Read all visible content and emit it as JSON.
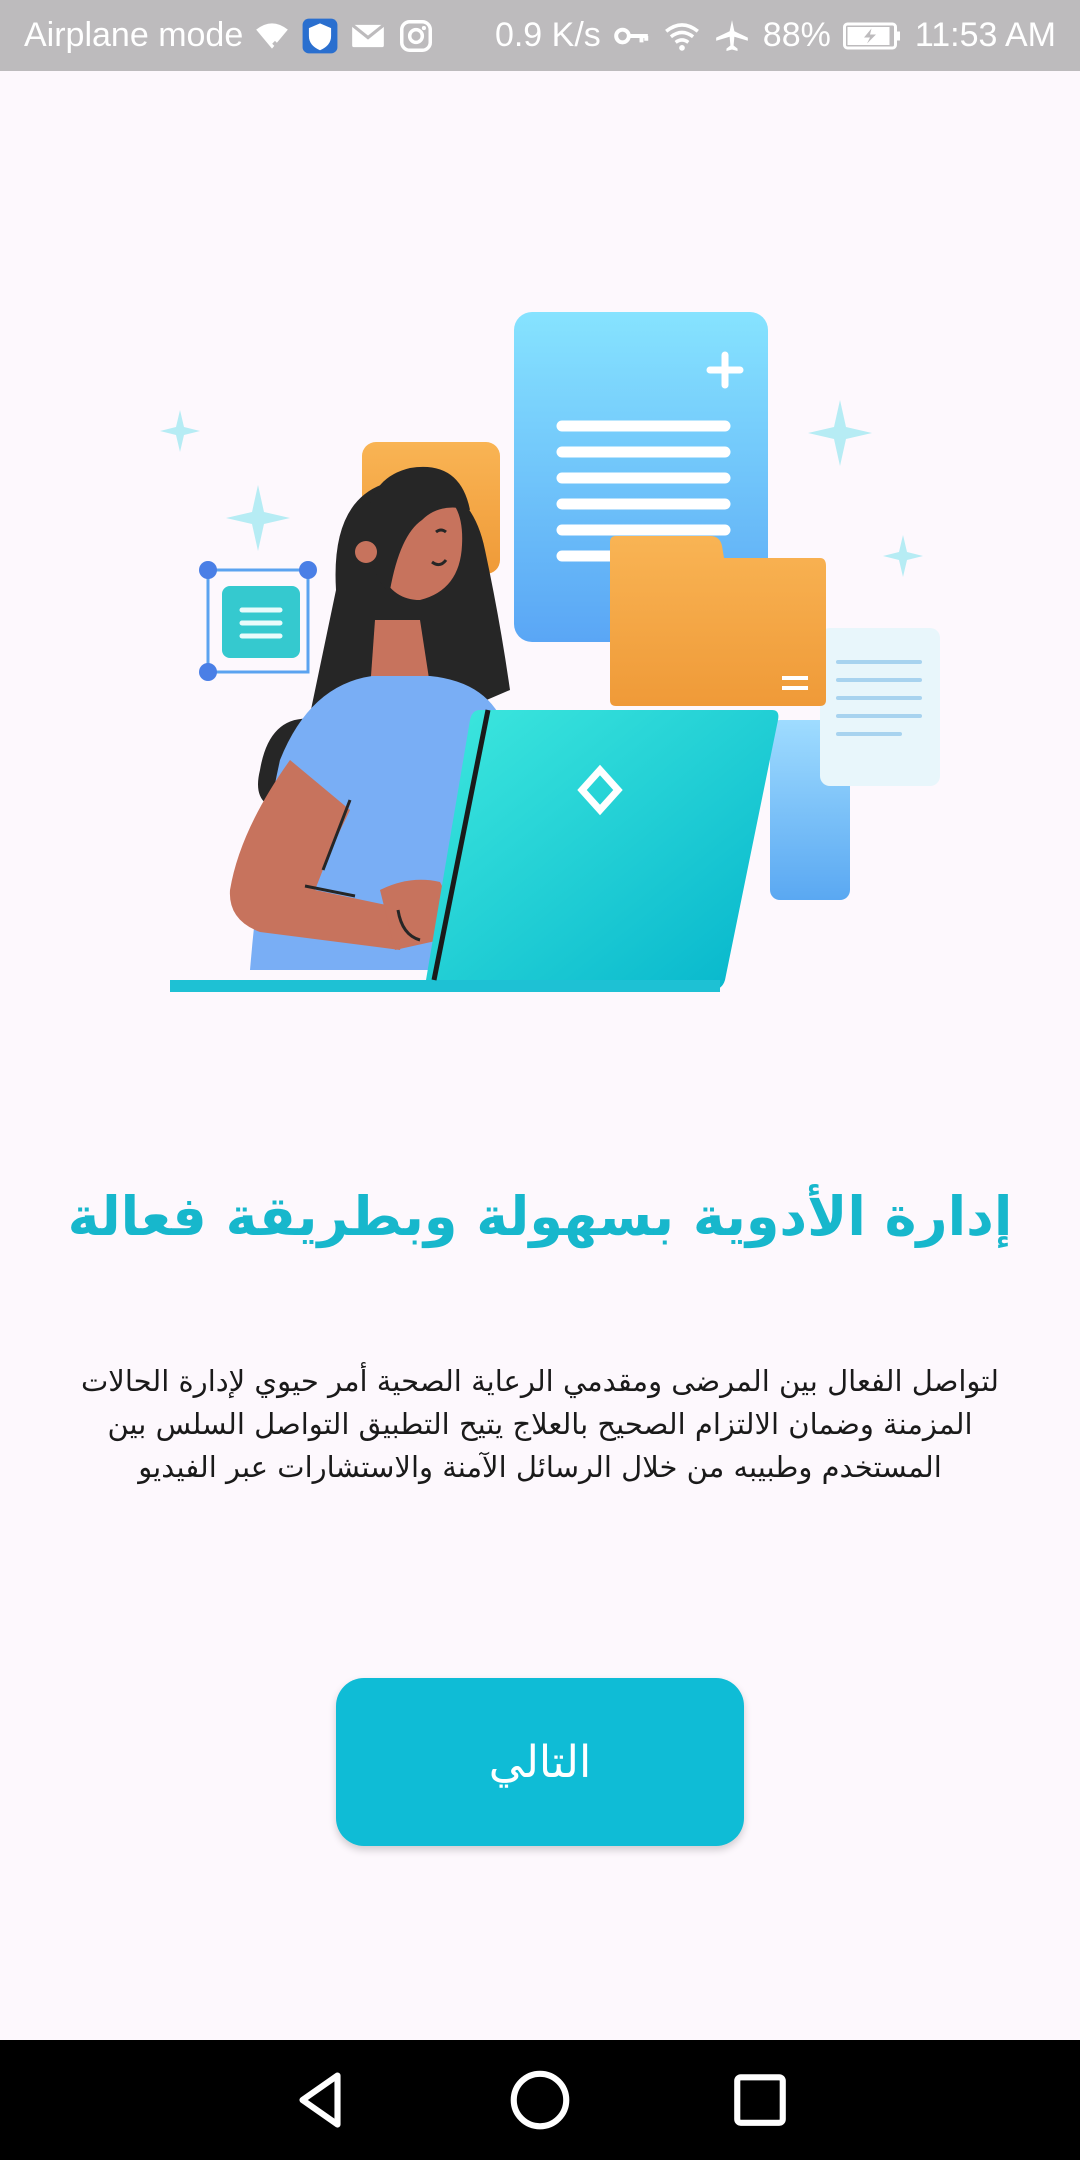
{
  "status_bar": {
    "left_text": "Airplane mode",
    "speed": "0.9 K/s",
    "battery": "88%",
    "time": "11:53 AM"
  },
  "onboarding": {
    "title": "إدارة الأدوية بسهولة وبطريقة فعالة",
    "description": "لتواصل الفعال بين المرضى ومقدمي الرعاية الصحية أمر حيوي لإدارة الحالات المزمنة وضمان الالتزام الصحيح بالعلاج يتيح التطبيق التواصل السلس بين المستخدم وطبيبه من خلال الرسائل الآمنة والاستشارات عبر الفيديو",
    "next_label": "التالي"
  },
  "colors": {
    "accent": "#0fbcd6",
    "title": "#17b7cc",
    "background": "#fdf8fd"
  },
  "nav_bar": {
    "icons": [
      "back-icon",
      "home-icon",
      "recents-icon"
    ]
  }
}
